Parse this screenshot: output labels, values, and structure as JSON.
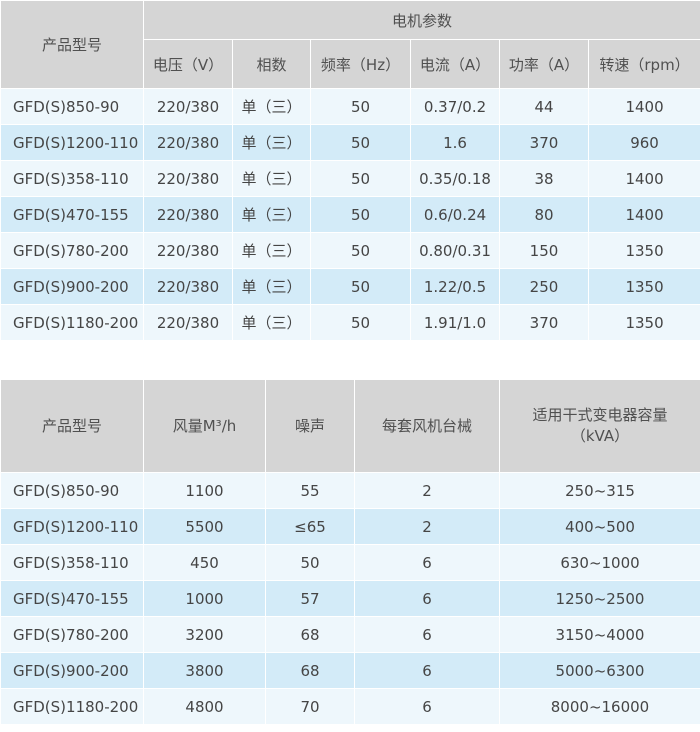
{
  "table1": {
    "model_header": "产品型号",
    "group_header": "电机参数",
    "columns": [
      "电压（V）",
      "相数",
      "频率（Hz）",
      "电流（A）",
      "功率（A）",
      "转速（rpm）"
    ],
    "rows": [
      [
        "GFD(S)850-90",
        "220/380",
        "单（三）",
        "50",
        "0.37/0.2",
        "44",
        "1400"
      ],
      [
        "GFD(S)1200-110",
        "220/380",
        "单（三）",
        "50",
        "1.6",
        "370",
        "960"
      ],
      [
        "GFD(S)358-110",
        "220/380",
        "单（三）",
        "50",
        "0.35/0.18",
        "38",
        "1400"
      ],
      [
        "GFD(S)470-155",
        "220/380",
        "单（三）",
        "50",
        "0.6/0.24",
        "80",
        "1400"
      ],
      [
        "GFD(S)780-200",
        "220/380",
        "单（三）",
        "50",
        "0.80/0.31",
        "150",
        "1350"
      ],
      [
        "GFD(S)900-200",
        "220/380",
        "单（三）",
        "50",
        "1.22/0.5",
        "250",
        "1350"
      ],
      [
        "GFD(S)1180-200",
        "220/380",
        "单（三）",
        "50",
        "1.91/1.0",
        "370",
        "1350"
      ]
    ]
  },
  "table2": {
    "columns": [
      "产品型号",
      "风量M³/h",
      "噪声",
      "每套风机台械",
      "适用干式变电器容量",
      "（kVA）"
    ],
    "rows": [
      [
        "GFD(S)850-90",
        "1100",
        "55",
        "2",
        "250~315"
      ],
      [
        "GFD(S)1200-110",
        "5500",
        "≤65",
        "2",
        "400~500"
      ],
      [
        "GFD(S)358-110",
        "450",
        "50",
        "6",
        "630~1000"
      ],
      [
        "GFD(S)470-155",
        "1000",
        "57",
        "6",
        "1250~2500"
      ],
      [
        "GFD(S)780-200",
        "3200",
        "68",
        "6",
        "3150~4000"
      ],
      [
        "GFD(S)900-200",
        "3800",
        "68",
        "6",
        "5000~6300"
      ],
      [
        "GFD(S)1180-200",
        "4800",
        "70",
        "6",
        "8000~16000"
      ]
    ]
  },
  "colors": {
    "header_bg": "#d5d5d5",
    "row_light": "#eef7fc",
    "row_dark": "#d3ebf8"
  }
}
